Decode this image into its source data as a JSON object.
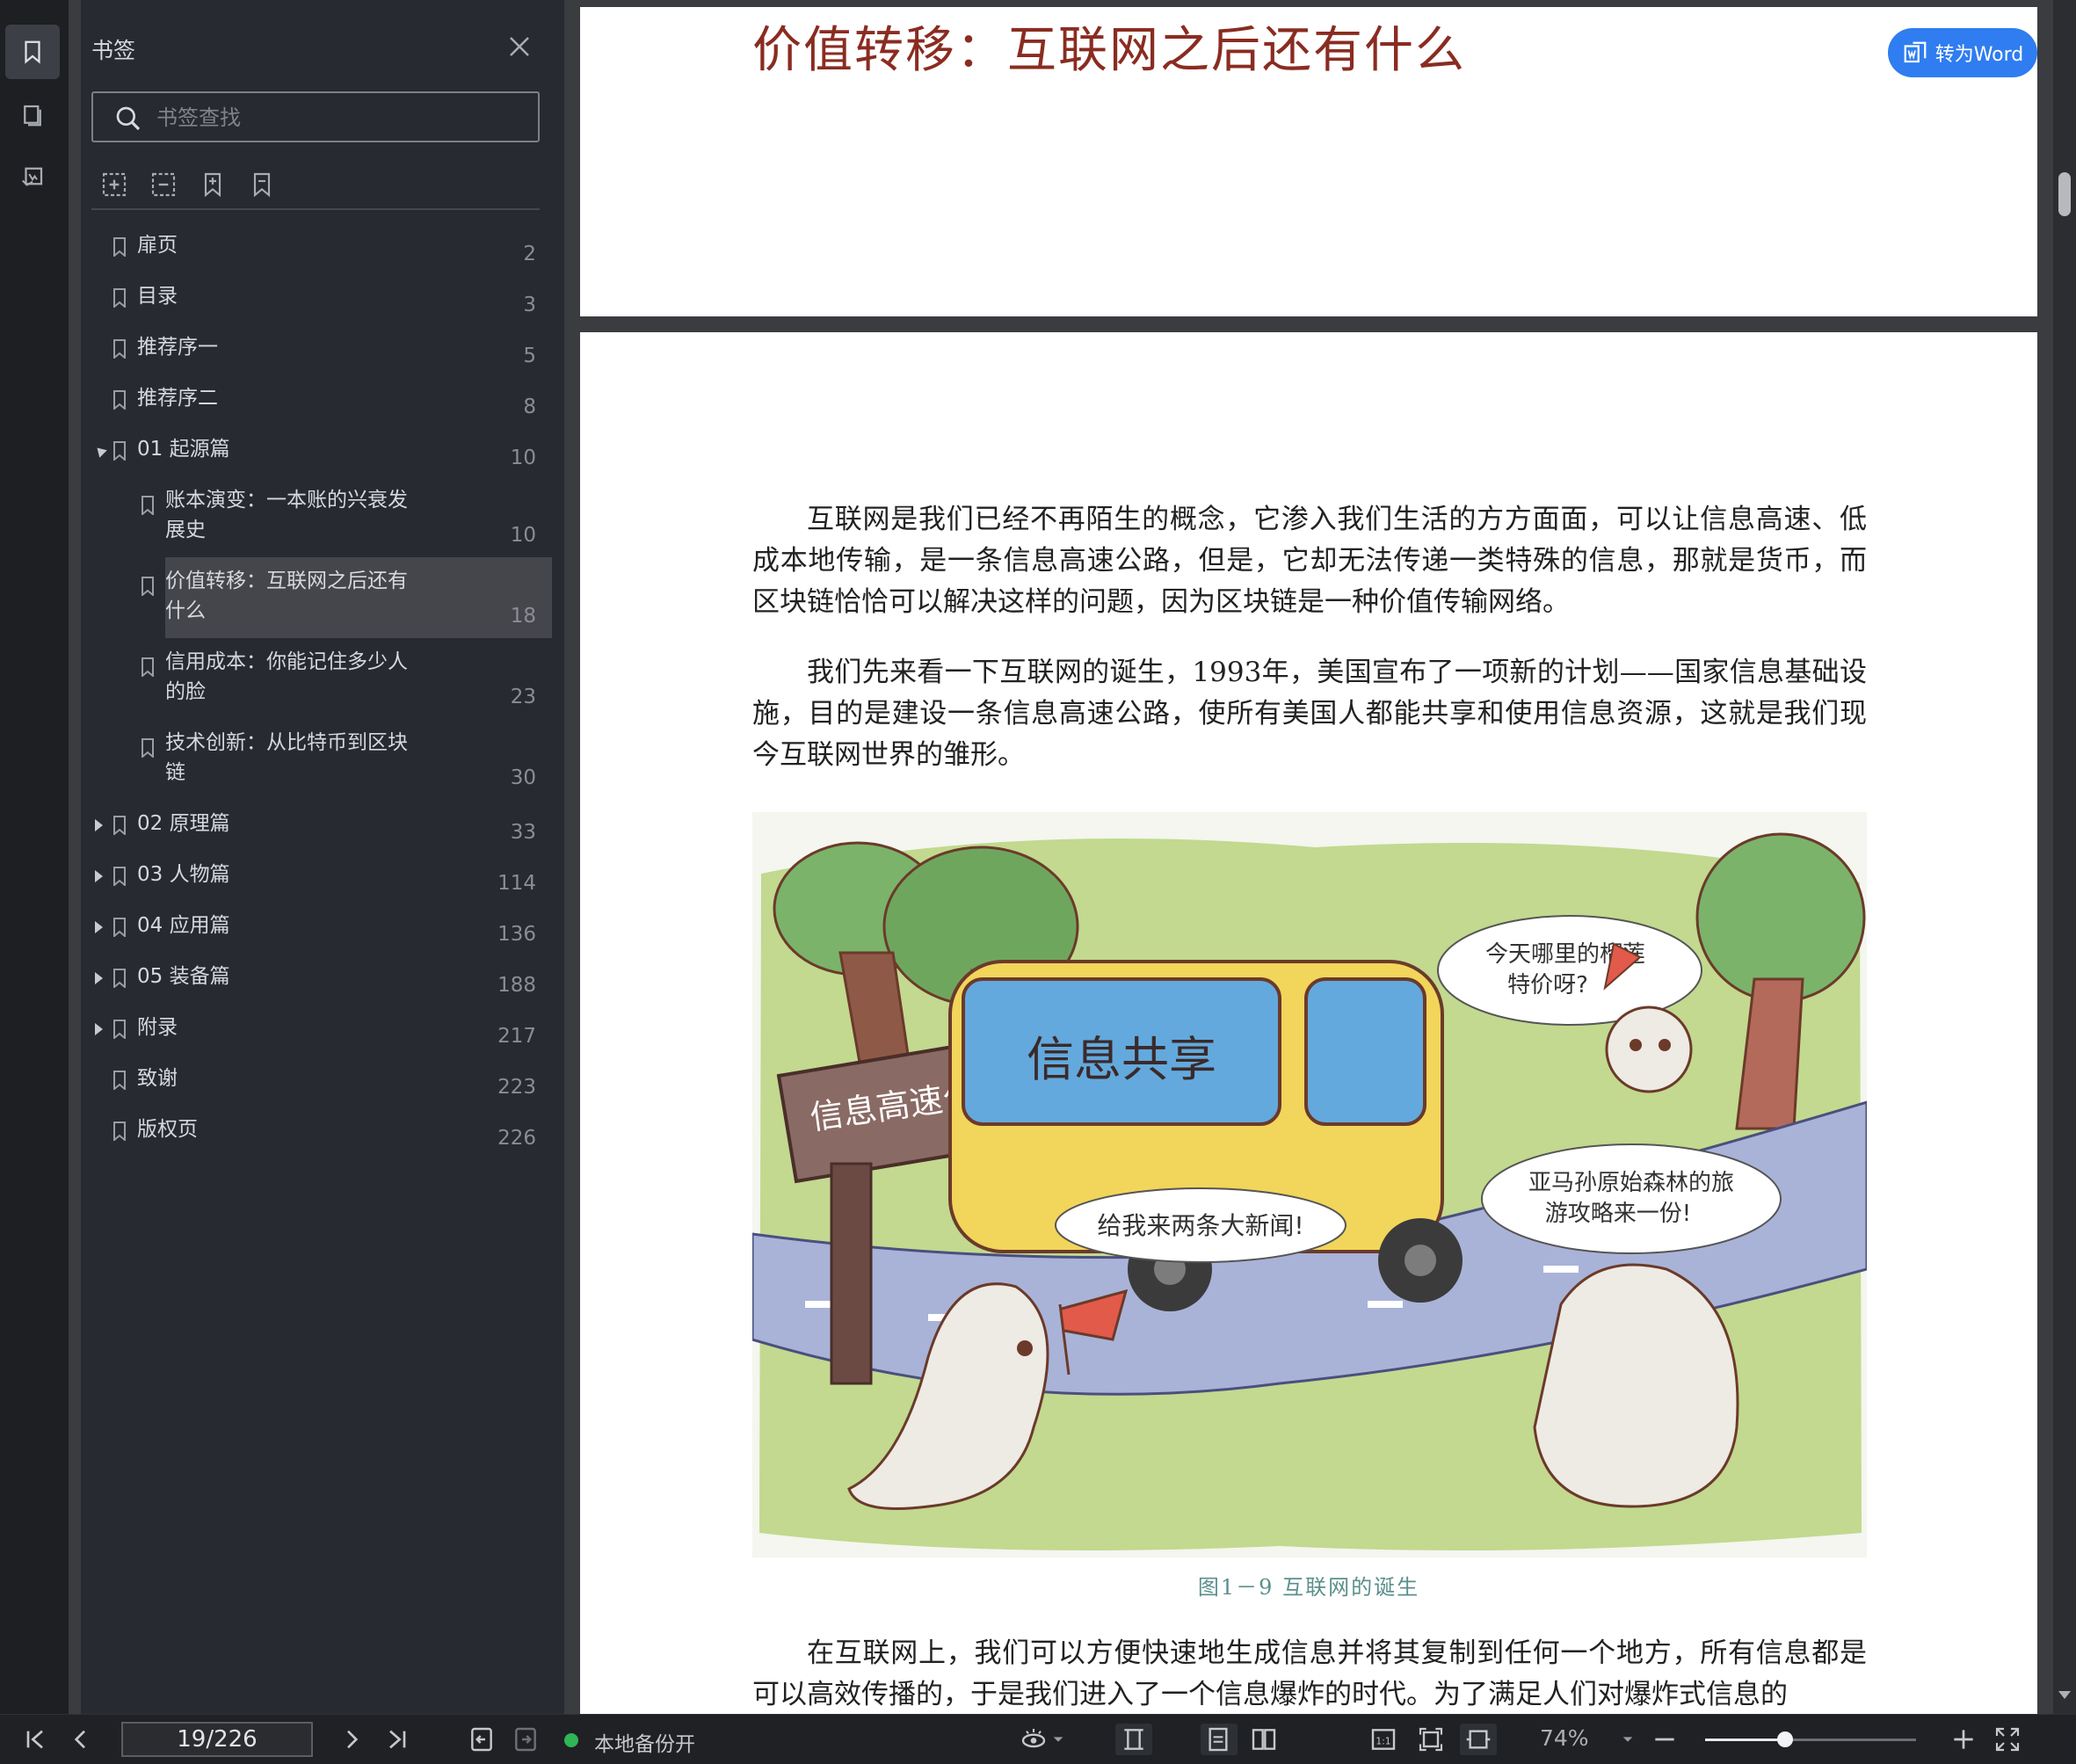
{
  "panel": {
    "title": "书签",
    "search_placeholder": "书签查找"
  },
  "bookmarks": [
    {
      "label": "扉页",
      "page": "2",
      "level": 0,
      "expander": "none"
    },
    {
      "label": "目录",
      "page": "3",
      "level": 0,
      "expander": "none"
    },
    {
      "label": "推荐序一",
      "page": "5",
      "level": 0,
      "expander": "none"
    },
    {
      "label": "推荐序二",
      "page": "8",
      "level": 0,
      "expander": "none"
    },
    {
      "label": "01 起源篇",
      "page": "10",
      "level": 0,
      "expander": "expanded"
    },
    {
      "label_lines": [
        "账本演变：一本账的兴衰发",
        "展史"
      ],
      "page": "10",
      "level": 1,
      "expander": "none"
    },
    {
      "label_lines": [
        "价值转移：互联网之后还有",
        "什么"
      ],
      "page": "18",
      "level": 1,
      "expander": "none",
      "selected": true
    },
    {
      "label_lines": [
        "信用成本：你能记住多少人",
        "的脸"
      ],
      "page": "23",
      "level": 1,
      "expander": "none"
    },
    {
      "label_lines": [
        "技术创新：从比特币到区块",
        "链"
      ],
      "page": "30",
      "level": 1,
      "expander": "none"
    },
    {
      "label": "02 原理篇",
      "page": "33",
      "level": 0,
      "expander": "collapsed"
    },
    {
      "label": "03 人物篇",
      "page": "114",
      "level": 0,
      "expander": "collapsed"
    },
    {
      "label": "04 应用篇",
      "page": "136",
      "level": 0,
      "expander": "collapsed"
    },
    {
      "label": "05 装备篇",
      "page": "188",
      "level": 0,
      "expander": "collapsed"
    },
    {
      "label": "附录",
      "page": "217",
      "level": 0,
      "expander": "collapsed"
    },
    {
      "label": "致谢",
      "page": "223",
      "level": 0,
      "expander": "none"
    },
    {
      "label": "版权页",
      "page": "226",
      "level": 0,
      "expander": "none"
    }
  ],
  "document": {
    "chapter_title": "价值转移：互联网之后还有什么",
    "paragraphs": [
      "互联网是我们已经不再陌生的概念，它渗入我们生活的方方面面，可以让信息高速、低成本地传输，是一条信息高速公路，但是，它却无法传递一类特殊的信息，那就是货币，而区块链恰恰可以解决这样的问题，因为区块链是一种价值传输网络。",
      "我们先来看一下互联网的诞生，1993年，美国宣布了一项新的计划——国家信息基础设施，目的是建设一条信息高速公路，使所有美国人都能共享和使用信息资源，这就是我们现今互联网世界的雏形。",
      "在互联网上，我们可以方便快速地生成信息并将其复制到任何一个地方，所有信息都是可以高效传播的，于是我们进入了一个信息爆炸的时代。为了满足人们对爆炸式信息的"
    ],
    "figure": {
      "sign_text": "信息高速公路",
      "bus_text": "信息共享",
      "bubble_left": "给我来两条大新闻!",
      "bubble_top": [
        "今天哪里的榴莲",
        "特价呀?"
      ],
      "bubble_right": [
        "亚马孙原始森林的旅",
        "游攻略来一份!"
      ],
      "caption": "图1－9  互联网的诞生"
    },
    "word_button": "转为Word"
  },
  "statusbar": {
    "page_indicator": "19/226",
    "backup_text": "本地备份开",
    "zoom_text": "74%",
    "zoom_level": 0.38
  },
  "colors": {
    "accent": "#2f7df0",
    "title_red": "#8a2c21",
    "caption_teal": "#5a8f8c",
    "backup_green": "#2fb655"
  }
}
